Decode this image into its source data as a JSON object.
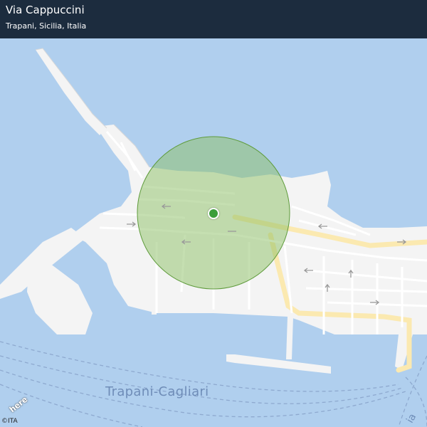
{
  "header": {
    "title": "Via Cappuccini",
    "subtitle": "Trapani, Sicilia, Italia"
  },
  "map": {
    "labels": {
      "ferry_route": "Trapani-Cagliari",
      "street_partial": "ia"
    },
    "branding": {
      "logo": "here",
      "copyright": "©ITA"
    },
    "marker": {
      "accuracy_circle_color": "#8cc063",
      "dot_color": "#3a9e3a"
    },
    "colors": {
      "water": "#b0cfee",
      "land": "#f4f4f4",
      "road_major": "#fdf0c6",
      "header_bg": "#1c2c3e"
    }
  }
}
